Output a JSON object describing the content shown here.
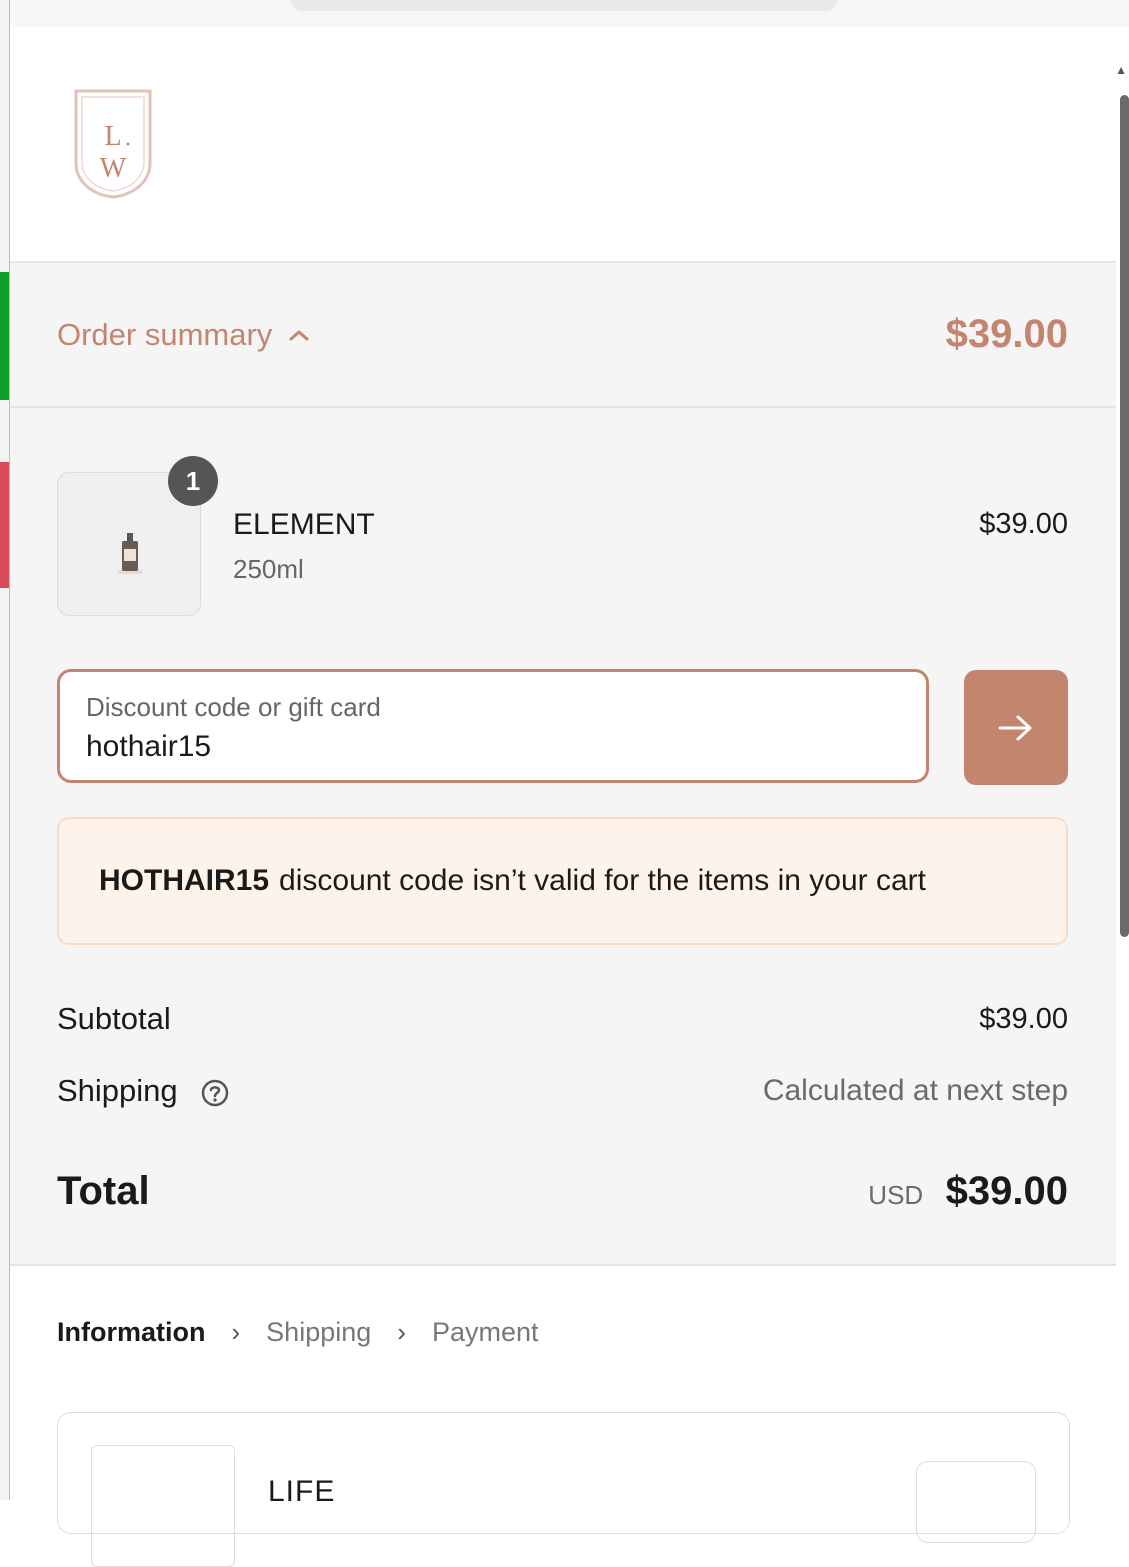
{
  "brand": {
    "logo_top": "L",
    "logo_bottom": "W"
  },
  "summary": {
    "toggle_label": "Order summary",
    "toggle_total": "$39.00",
    "chevron_icon": "chevron-up-icon",
    "accent_color": "#c4856f"
  },
  "cart": {
    "items": [
      {
        "quantity": "1",
        "name": "ELEMENT",
        "variant": "250ml",
        "price": "$39.00"
      }
    ]
  },
  "discount": {
    "label": "Discount code or gift card",
    "value": "hothair15",
    "apply_icon": "arrow-right-icon"
  },
  "error": {
    "code": "HOTHAIR15",
    "message": "discount code isn’t valid for the items in your cart"
  },
  "totals": {
    "subtotal_label": "Subtotal",
    "subtotal_value": "$39.00",
    "shipping_label": "Shipping",
    "shipping_value": "Calculated at next step",
    "total_label": "Total",
    "currency": "USD",
    "total_value": "$39.00"
  },
  "breadcrumb": {
    "steps": [
      "Information",
      "Shipping",
      "Payment"
    ]
  },
  "express": {
    "partial_text": "LIFE"
  }
}
